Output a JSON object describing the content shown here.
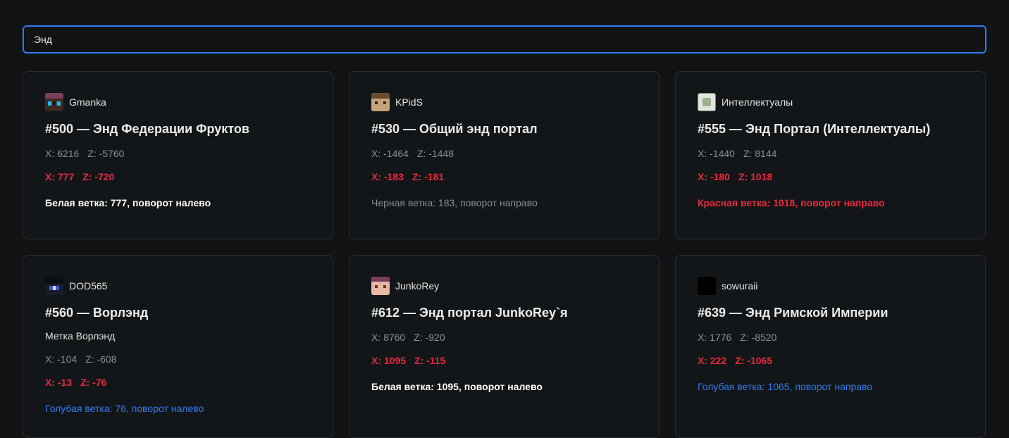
{
  "search": {
    "value": "Энд"
  },
  "portals": [
    {
      "author": "Gmanka",
      "avatar": "gmanka-avatar",
      "title": "#500 — Энд Федерации Фруктов",
      "note": "",
      "overworld": {
        "x": "X: 6216",
        "z": "Z: -5760"
      },
      "nether": {
        "x": "X: 777",
        "z": "Z: -720"
      },
      "branch": "Белая ветка: 777, поворот налево",
      "branch_color": "white"
    },
    {
      "author": "KPidS",
      "avatar": "kpids-avatar",
      "title": "#530 — Общий энд портал",
      "note": "",
      "overworld": {
        "x": "X: -1464",
        "z": "Z: -1448"
      },
      "nether": {
        "x": "X: -183",
        "z": "Z: -181"
      },
      "branch": "Черная ветка: 183, поворот направо",
      "branch_color": "black"
    },
    {
      "author": "Интеллектуалы",
      "avatar": "intellectualy-avatar",
      "title": "#555 — Энд Портал (Интеллектуалы)",
      "note": "",
      "overworld": {
        "x": "X: -1440",
        "z": "Z: 8144"
      },
      "nether": {
        "x": "X: -180",
        "z": "Z: 1018"
      },
      "branch": "Красная ветка: 1018, поворот направо",
      "branch_color": "red"
    },
    {
      "author": "DOD565",
      "avatar": "dod565-avatar",
      "title": "#560 — Ворлэнд",
      "note": "Метка Ворлэнд",
      "overworld": {
        "x": "X: -104",
        "z": "Z: -608"
      },
      "nether": {
        "x": "X: -13",
        "z": "Z: -76"
      },
      "branch": "Голубая ветка: 76, поворот налево",
      "branch_color": "blue"
    },
    {
      "author": "JunkoRey",
      "avatar": "junkorey-avatar",
      "title": "#612 — Энд портал JunkoRey`я",
      "note": "",
      "overworld": {
        "x": "X: 8760",
        "z": "Z: -920"
      },
      "nether": {
        "x": "X: 1095",
        "z": "Z: -115"
      },
      "branch": "Белая ветка: 1095, поворот налево",
      "branch_color": "white"
    },
    {
      "author": "sowuraii",
      "avatar": "sowuraii-avatar",
      "title": "#639 — Энд Римской Империи",
      "note": "",
      "overworld": {
        "x": "X: 1776",
        "z": "Z: -8520"
      },
      "nether": {
        "x": "X: 222",
        "z": "Z: -1065"
      },
      "branch": "Голубая ветка: 1065, поворот направо",
      "branch_color": "blue"
    }
  ],
  "colors": {
    "accent": "#2f7bf0",
    "nether": "#e8283e",
    "background": "#111315"
  }
}
